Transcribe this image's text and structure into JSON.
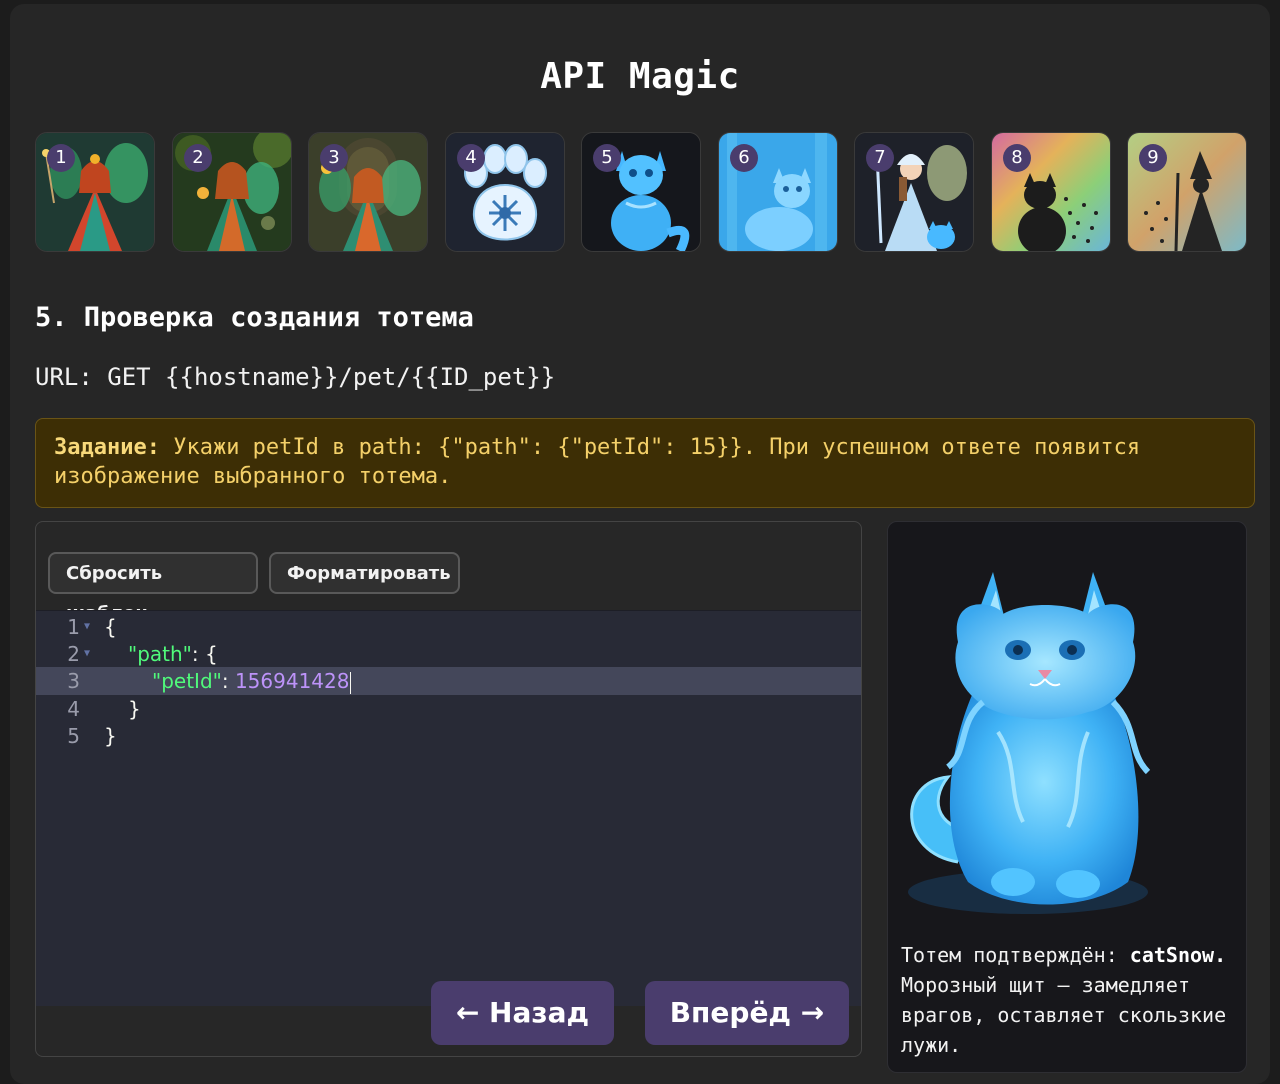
{
  "app": {
    "title": "API Magic"
  },
  "thumbnails": [
    {
      "number": "1",
      "subject": "fairy with wand",
      "colors": [
        "#1c4a3a",
        "#e0603a"
      ]
    },
    {
      "number": "2",
      "subject": "fairy in forest",
      "colors": [
        "#2d4a1f",
        "#c86a2a"
      ]
    },
    {
      "number": "3",
      "subject": "fairy at doorway",
      "colors": [
        "#3a4a2a",
        "#d06f34"
      ]
    },
    {
      "number": "4",
      "subject": "snowflake paw",
      "colors": [
        "#1f2430",
        "#d8ecff"
      ]
    },
    {
      "number": "5",
      "subject": "ice cat",
      "colors": [
        "#15171c",
        "#3fb6ff"
      ]
    },
    {
      "number": "6",
      "subject": "ice cat in blue forest",
      "colors": [
        "#3ba3e6",
        "#79d2ff"
      ]
    },
    {
      "number": "7",
      "subject": "snow maiden with cat",
      "colors": [
        "#1e2129",
        "#b6d8f4"
      ]
    },
    {
      "number": "8",
      "subject": "black cat on rainbow",
      "colors": [
        "#c96b6b",
        "#2a2a2a"
      ]
    },
    {
      "number": "9",
      "subject": "wizard silhouette",
      "colors": [
        "#a3c27a",
        "#2d2d2d"
      ]
    }
  ],
  "step": {
    "title": "5. Проверка создания тотема",
    "url": "URL: GET {{hostname}}/pet/{{ID_pet}}"
  },
  "task": {
    "label": "Задание:",
    "text": " Укажи petId в path: {\"path\": {\"petId\": 15}}. При успешном ответе появится изображение выбранного тотема."
  },
  "toolbar": {
    "reset_label": "Сбросить шаблон",
    "format_label": "Форматировать"
  },
  "editor": {
    "line_numbers": [
      "1",
      "2",
      "3",
      "4",
      "5"
    ],
    "open_brace": "{",
    "path_key": "\"path\"",
    "colon_open": ": {",
    "petid_key": "\"petId\"",
    "colon": ": ",
    "petid_value": "156941428",
    "inner_close": "}",
    "outer_close": "}"
  },
  "nav": {
    "back_label": "← Назад",
    "next_label": "Вперёд →"
  },
  "result": {
    "lead": "Тотем подтверждён: ",
    "name": "catSnow.",
    "description": " Морозный щит — замедляет врагов, оставляет скользкие лужи.",
    "image_subject": "ice cat"
  },
  "colors": {
    "accent": "#4a3d6d",
    "task_background": "#3d2e05",
    "task_text": "#f4d069",
    "code_key": "#50fa7b",
    "code_number": "#bd93f9"
  }
}
